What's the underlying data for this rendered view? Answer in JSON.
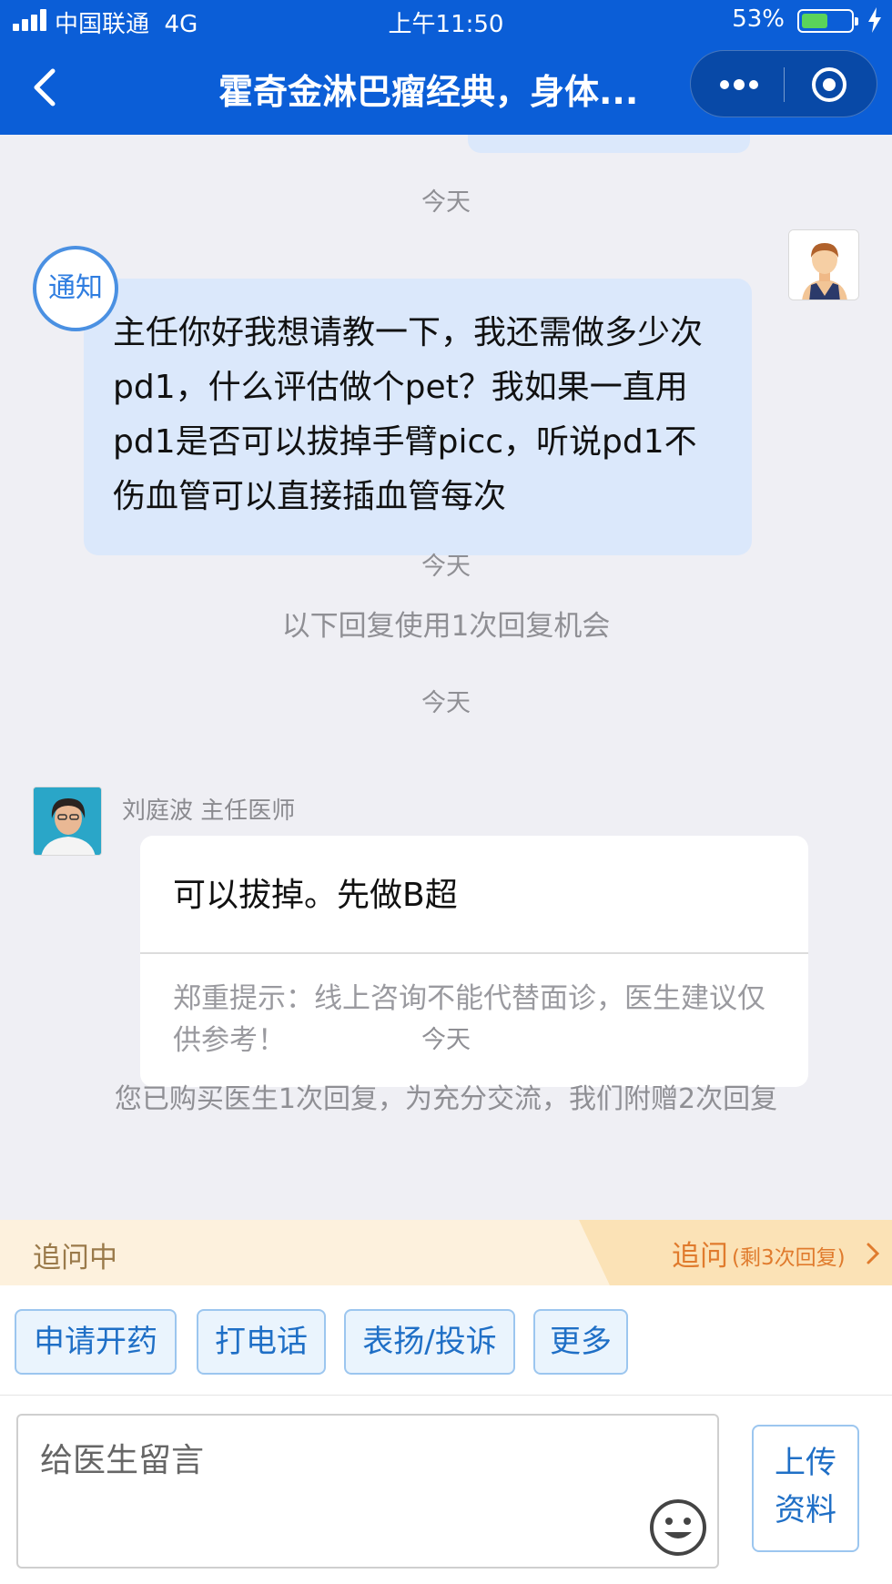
{
  "status_bar": {
    "carrier": "中国联通",
    "network": "4G",
    "time": "上午11:50",
    "battery": "53%",
    "battery_level": 0.53
  },
  "header": {
    "title": "霍奇金淋巴瘤经典，身体...",
    "icons": {
      "back": "chevron-left-icon",
      "more": "more-dots-icon",
      "close": "target-icon"
    }
  },
  "chat": {
    "time_label_1": "今天",
    "notice_badge": "通知",
    "user_message": "主任你好我想请教一下，我还需做多少次pd1，什么评估做个pet？我如果一直用pd1是否可以拔掉手臂picc，听说pd1不伤血管可以直接插血管每次",
    "time_label_2": "今天",
    "reply_notice": "以下回复使用1次回复机会",
    "time_label_3": "今天",
    "doctor_name": "刘庭波 主任医师",
    "doctor_reply": "可以拔掉。先做B超",
    "disclaimer": "郑重提示：线上咨询不能代替面诊，医生建议仅供参考！",
    "time_label_4": "今天",
    "cut_message": "您已购买医生1次回复，为充分交流，我们附赠2次回复"
  },
  "follow_bar": {
    "status": "追问中",
    "action": "追问",
    "remaining": "(剩3次回复)"
  },
  "actions": [
    "申请开药",
    "打电话",
    "表扬/投诉",
    "更多"
  ],
  "input": {
    "placeholder": "给医生留言",
    "upload_line1": "上传",
    "upload_line2": "资料"
  },
  "colors": {
    "header_bg": "#0b5ed7",
    "user_bubble": "#dbe8fb",
    "accent_orange": "#e07b2d",
    "button_blue": "#1f6fc6"
  }
}
